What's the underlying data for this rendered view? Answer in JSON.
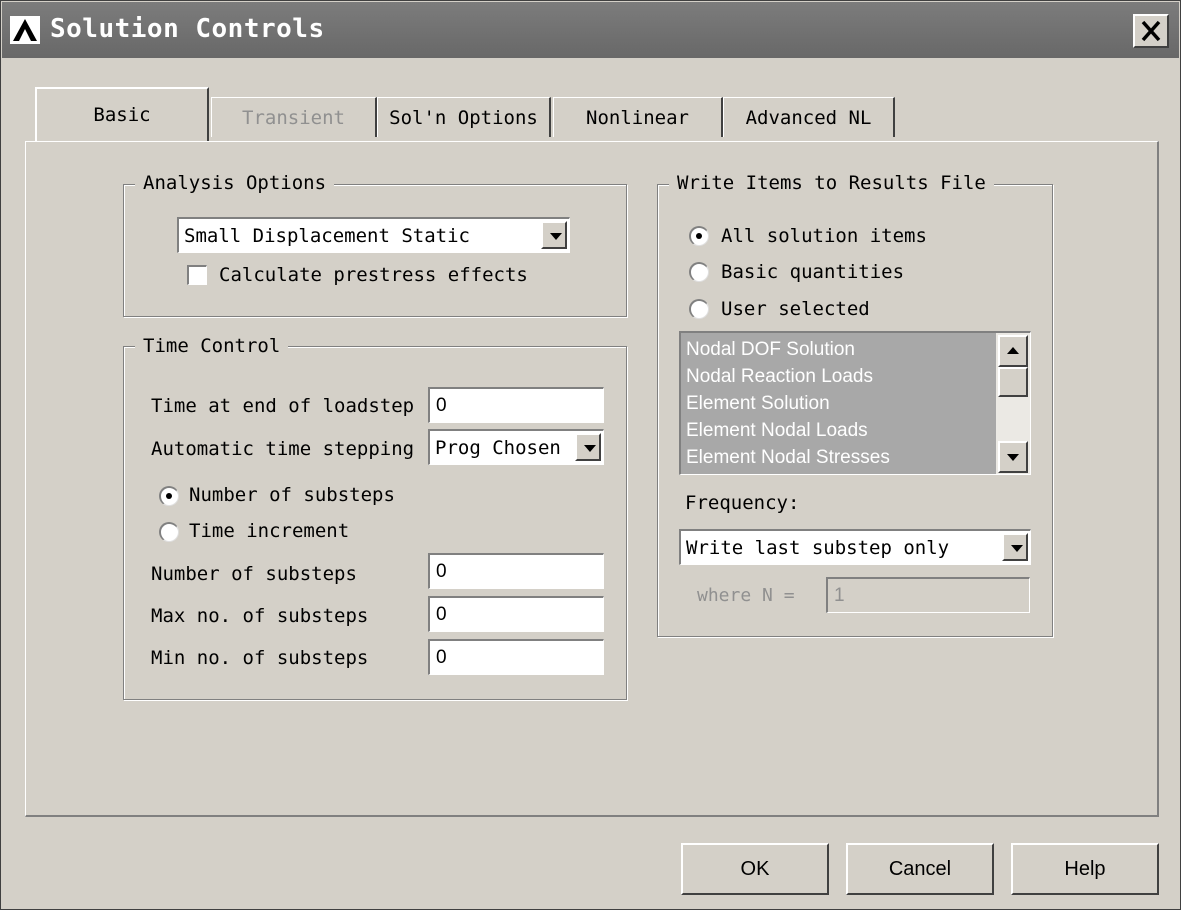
{
  "window": {
    "title": "Solution Controls"
  },
  "tabs": [
    {
      "label": "Basic"
    },
    {
      "label": "Transient"
    },
    {
      "label": "Sol'n Options"
    },
    {
      "label": "Nonlinear"
    },
    {
      "label": "Advanced NL"
    }
  ],
  "analysis_options": {
    "legend": "Analysis Options",
    "analysis_type": "Small Displacement Static",
    "prestress_label": "Calculate prestress effects",
    "prestress_checked": false
  },
  "time_control": {
    "legend": "Time Control",
    "end_time_label": "Time at end of loadstep",
    "end_time_value": "0",
    "auto_step_label": "Automatic time stepping",
    "auto_step_value": "Prog Chosen",
    "radio_substeps_label": "Number of substeps",
    "radio_time_increment_label": "Time increment",
    "selected_mode": "Number of substeps",
    "num_substeps_label": "Number of substeps",
    "num_substeps_value": "0",
    "max_substeps_label": "Max no. of substeps",
    "max_substeps_value": "0",
    "min_substeps_label": "Min no. of substeps",
    "min_substeps_value": "0"
  },
  "write_items": {
    "legend": "Write Items to Results File",
    "radio_all_label": "All solution items",
    "radio_basic_label": "Basic quantities",
    "radio_user_label": "User selected",
    "selected": "All solution items",
    "list_items": [
      "Nodal DOF Solution",
      "Nodal Reaction Loads",
      "Element Solution",
      "Element Nodal Loads",
      "Element Nodal Stresses"
    ],
    "frequency_label": "Frequency:",
    "frequency_value": "Write last substep only",
    "where_n_label": "where N =",
    "where_n_value": "1"
  },
  "buttons": {
    "ok": "OK",
    "cancel": "Cancel",
    "help": "Help"
  },
  "colors": {
    "dialog_bg": "#d4d0c8",
    "titlebar": "#6e6e6e",
    "list_bg": "#a8a8a8"
  }
}
